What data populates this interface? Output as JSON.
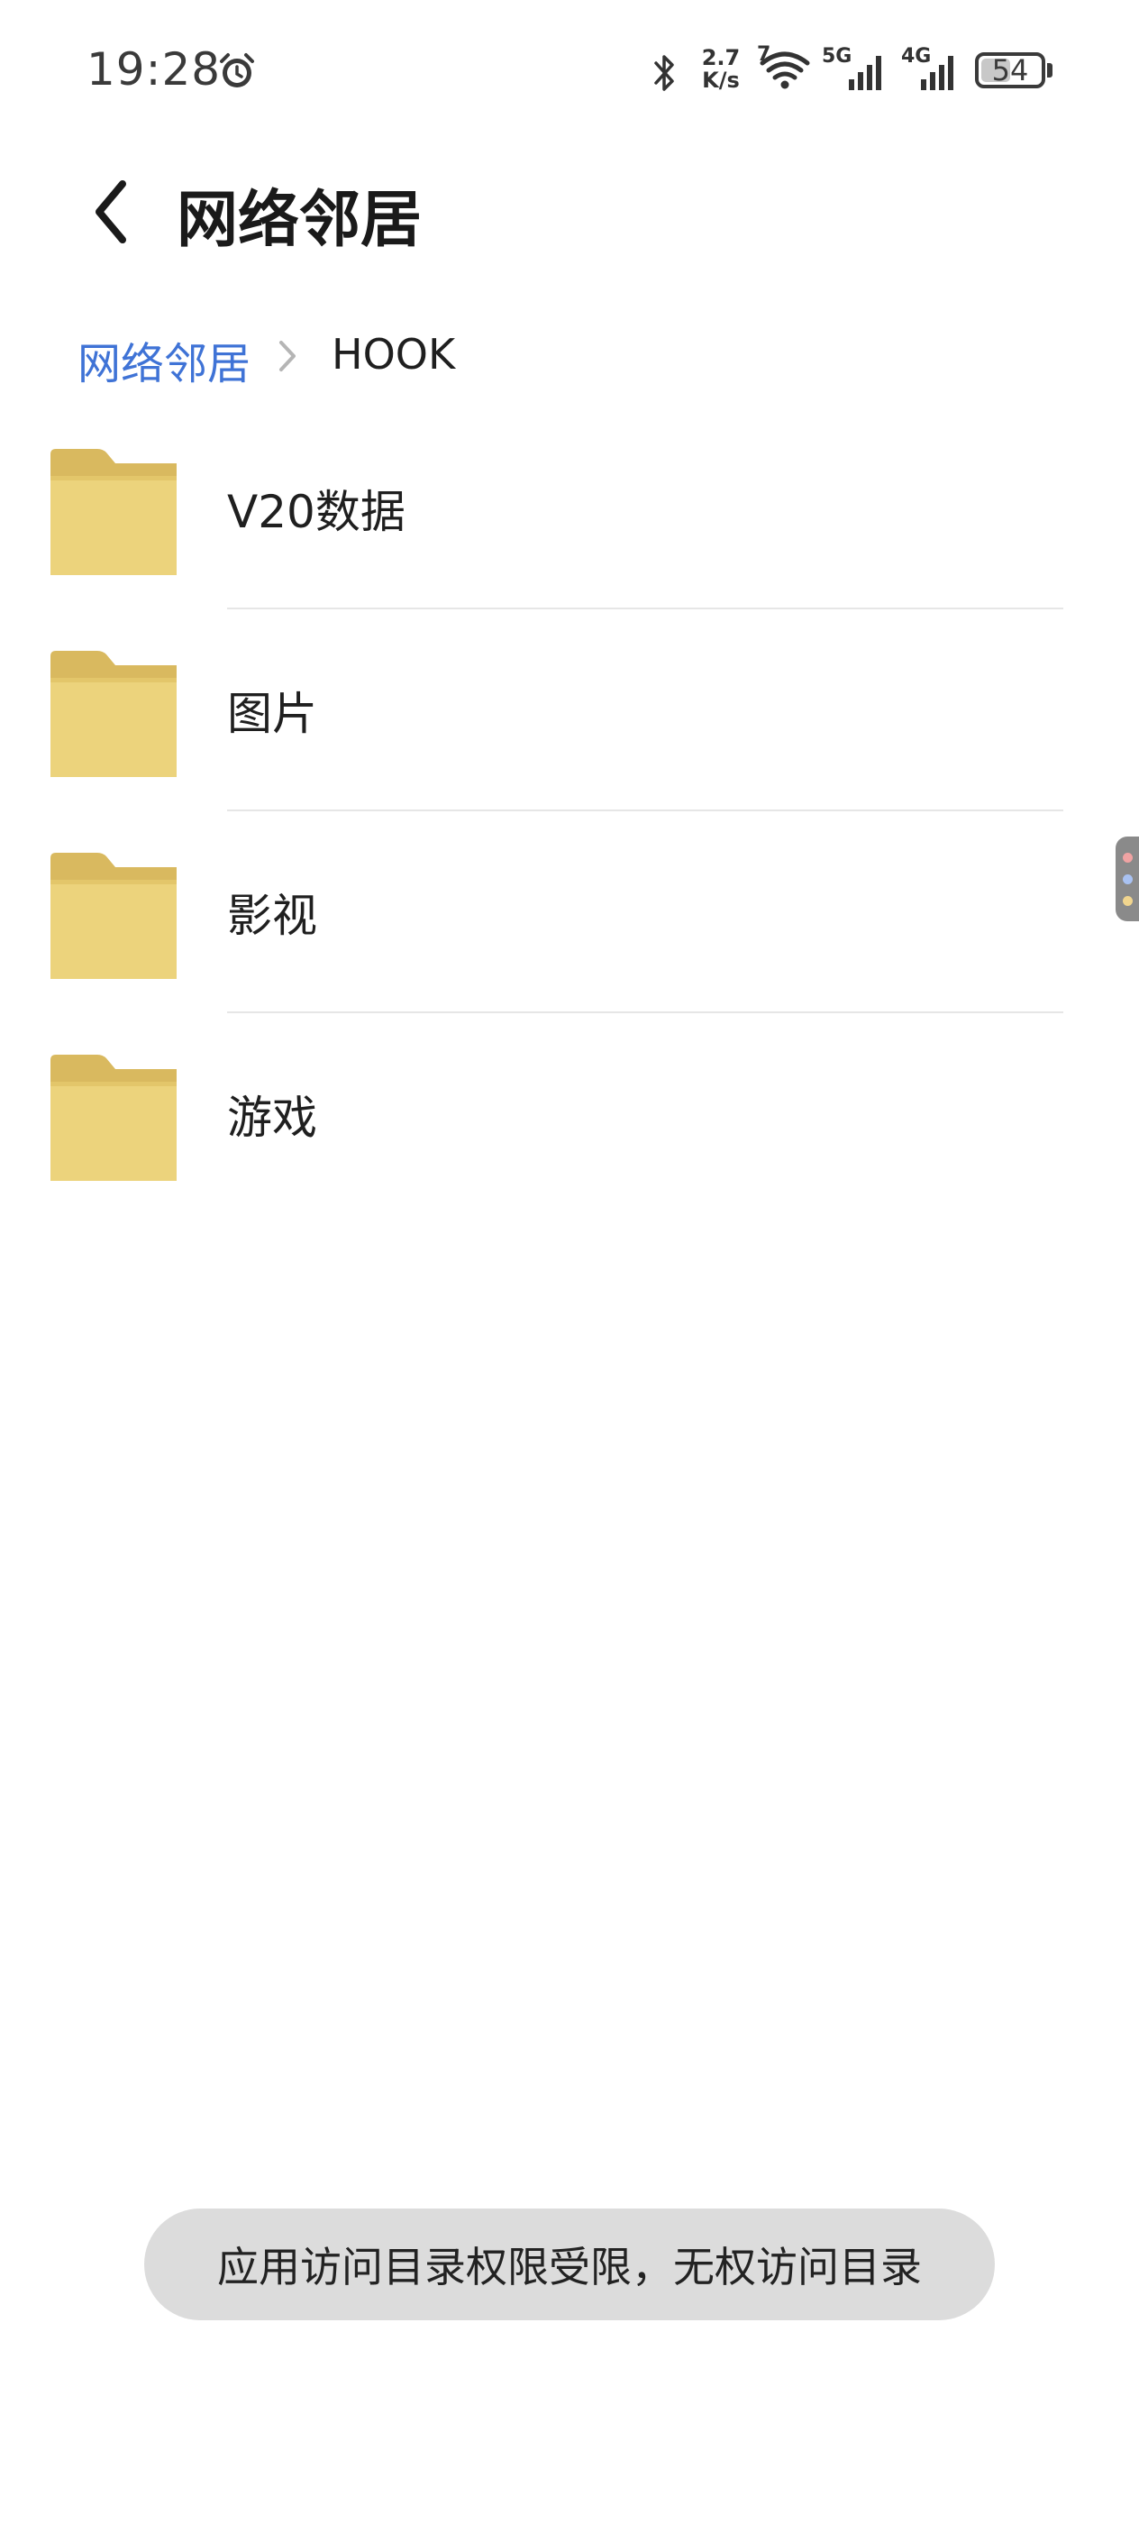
{
  "status_bar": {
    "time": "19:28",
    "net_speed_value": "2.7",
    "net_speed_unit": "K/s",
    "wifi_badge": "7",
    "sim1_label": "5G",
    "sim2_label": "4G",
    "battery_level": "54",
    "icons": [
      "alarm-icon",
      "bluetooth-icon",
      "wifi-icon",
      "signal-icon",
      "signal-icon",
      "battery-icon"
    ]
  },
  "header": {
    "back_icon": "chevron-left-icon",
    "title": "网络邻居"
  },
  "breadcrumb": {
    "root": "网络邻居",
    "separator_icon": "chevron-right-icon",
    "current": "HOOK"
  },
  "folders": [
    {
      "name": "V20数据",
      "icon": "folder-icon"
    },
    {
      "name": "图片",
      "icon": "folder-icon"
    },
    {
      "name": "影视",
      "icon": "folder-icon"
    },
    {
      "name": "游戏",
      "icon": "folder-icon"
    }
  ],
  "toast": {
    "message": "应用访问目录权限受限，无权访问目录"
  },
  "colors": {
    "accent": "#3f73d6",
    "folder_body": "#ecd37c",
    "folder_tab": "#d9b95f",
    "toast_bg": "#dcdcdc"
  }
}
